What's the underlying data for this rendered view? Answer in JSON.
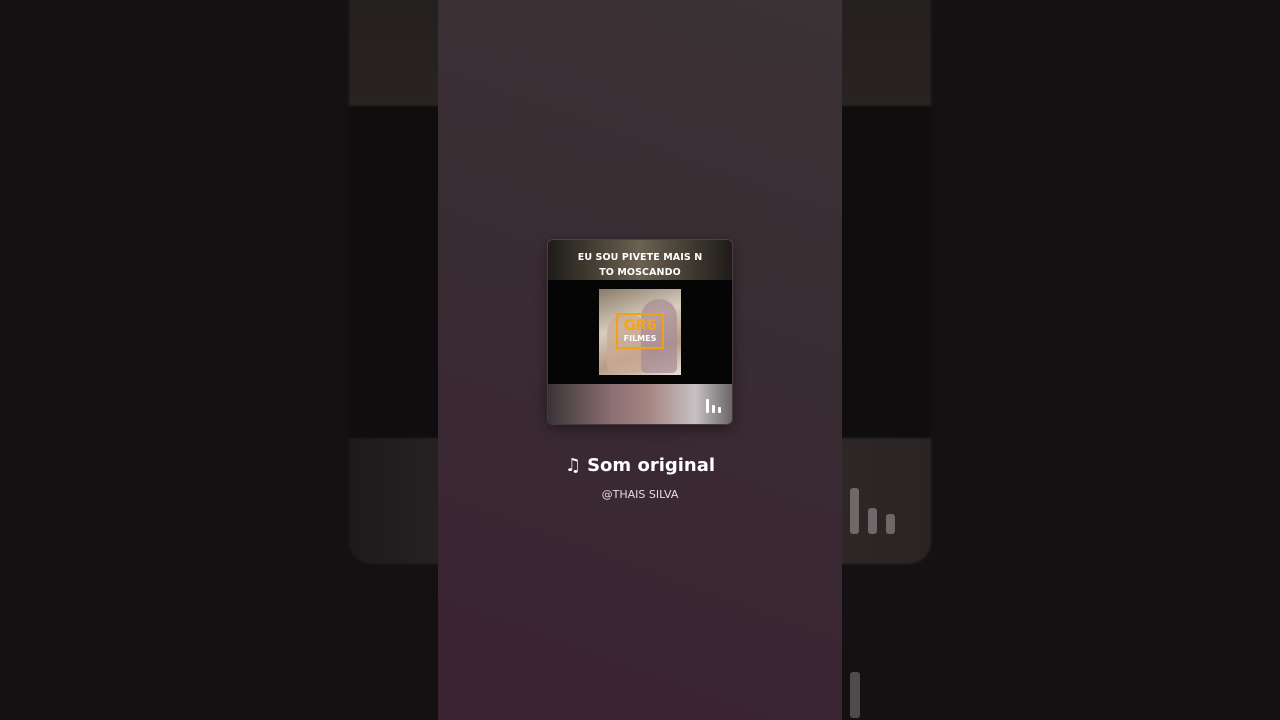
{
  "cover": {
    "caption_line1": "EU SOU PIVETE MAIS N",
    "caption_line2": "TO MOSCANDO",
    "logo_main": "GR6",
    "logo_sub": "FILMES",
    "eq_icon": "equalizer-icon"
  },
  "sound": {
    "note_icon": "♫",
    "title": "Som original",
    "artist": "@THAIS SILVA"
  },
  "colors": {
    "panel_top": "#3a3234",
    "panel_bottom": "#3a2232",
    "logo_accent": "#f4a51c",
    "text_primary": "#ffffff"
  }
}
